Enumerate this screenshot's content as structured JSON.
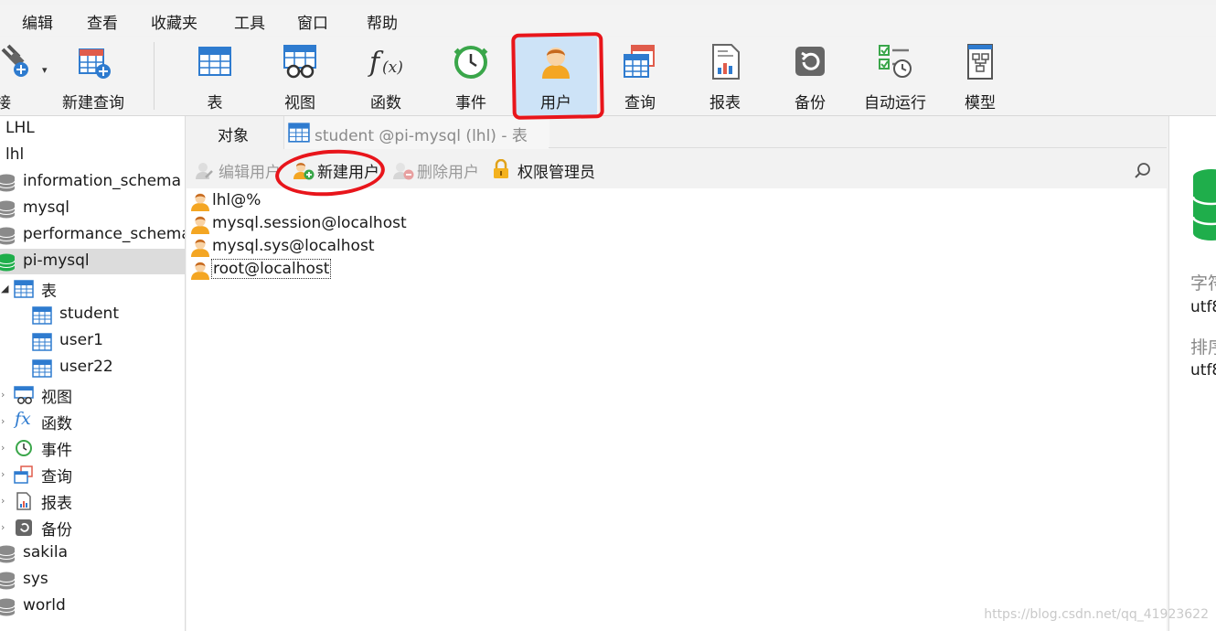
{
  "menu": [
    "编辑",
    "查看",
    "收藏夹",
    "工具",
    "窗口",
    "帮助"
  ],
  "toolbar": {
    "connect_label": "连接",
    "new_query_label": "新建查询",
    "buttons": [
      "表",
      "视图",
      "函数",
      "事件",
      "用户",
      "查询",
      "报表",
      "备份",
      "自动运行",
      "模型"
    ],
    "active": "用户"
  },
  "sidebar": {
    "items": [
      "LHL",
      "lhl",
      "information_schema",
      "mysql",
      "performance_schema",
      "pi-mysql",
      "表",
      "student",
      "user1",
      "user22",
      "视图",
      "函数",
      "事件",
      "查询",
      "报表",
      "备份",
      "sakila",
      "sys",
      "world"
    ],
    "selected": "pi-mysql"
  },
  "tabs": {
    "objects": "对象",
    "table_tab": "student @pi-mysql (lhl) - 表"
  },
  "subtoolbar": {
    "edit_user": "编辑用户",
    "new_user": "新建用户",
    "delete_user": "删除用户",
    "privilege_manager": "权限管理员"
  },
  "users": [
    "lhl@%",
    "mysql.session@localhost",
    "mysql.sys@localhost",
    "root@localhost"
  ],
  "right_panel": {
    "charset_label": "字符集",
    "charset_value": "utf8",
    "collation_label": "排序规则",
    "collation_value": "utf8"
  },
  "watermark": "https://blog.csdn.net/qq_41923622",
  "colors": {
    "accent": "#2e7bcf",
    "selected_tool": "#cde3f7",
    "annotation": "#e8151b",
    "db_green": "#1fae4b"
  }
}
